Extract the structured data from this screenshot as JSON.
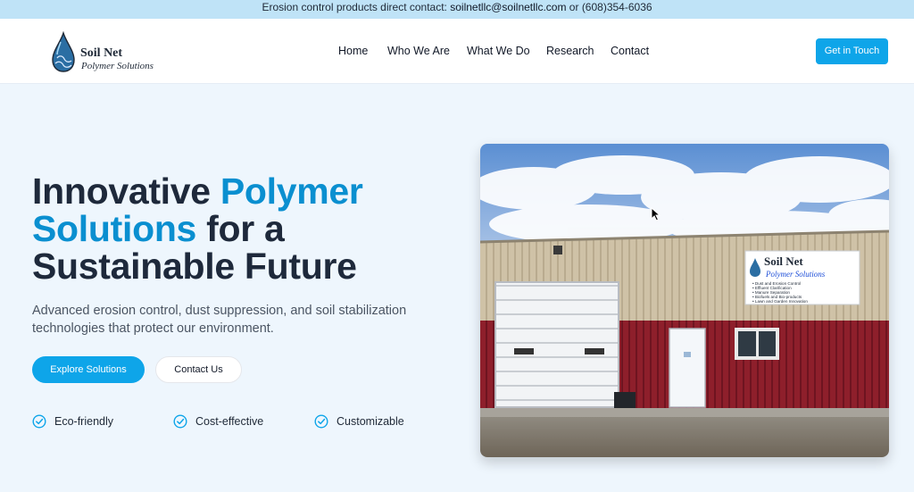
{
  "topbar": {
    "text": "Erosion control products direct contact: ",
    "email": "soilnetllc@soilnetllc.com",
    "or": " or ",
    "phone": "(608)354-6036"
  },
  "logo": {
    "name": "Soil Net",
    "tagline": "Polymer Solutions"
  },
  "nav": {
    "items": [
      "Home",
      "Who We Are",
      "What We Do",
      "Research",
      "Contact"
    ],
    "cta": "Get in Touch"
  },
  "hero": {
    "title_1": "Innovative ",
    "title_accent": "Polymer Solutions",
    "title_2": " for a Sustainable Future",
    "subtitle": "Advanced erosion control, dust suppression, and soil stabilization technologies that protect our environment.",
    "primary_button": "Explore Solutions",
    "secondary_button": "Contact Us",
    "features": [
      "Eco-friendly",
      "Cost-effective",
      "Customizable"
    ]
  },
  "photo": {
    "sign_name": "Soil Net",
    "sign_tagline": "Polymer Solutions",
    "sign_lines": [
      "• Dust and Erosion Control",
      "• Effluent Clarification",
      "• Manure Separation",
      "• Biofuels and Bio-products",
      "• Lawn and Garden Innovation"
    ]
  },
  "colors": {
    "accent": "#0ea5e9",
    "title_accent": "#0a8fd0",
    "topbar": "#bfe3f7",
    "background": "#eef6fd"
  }
}
